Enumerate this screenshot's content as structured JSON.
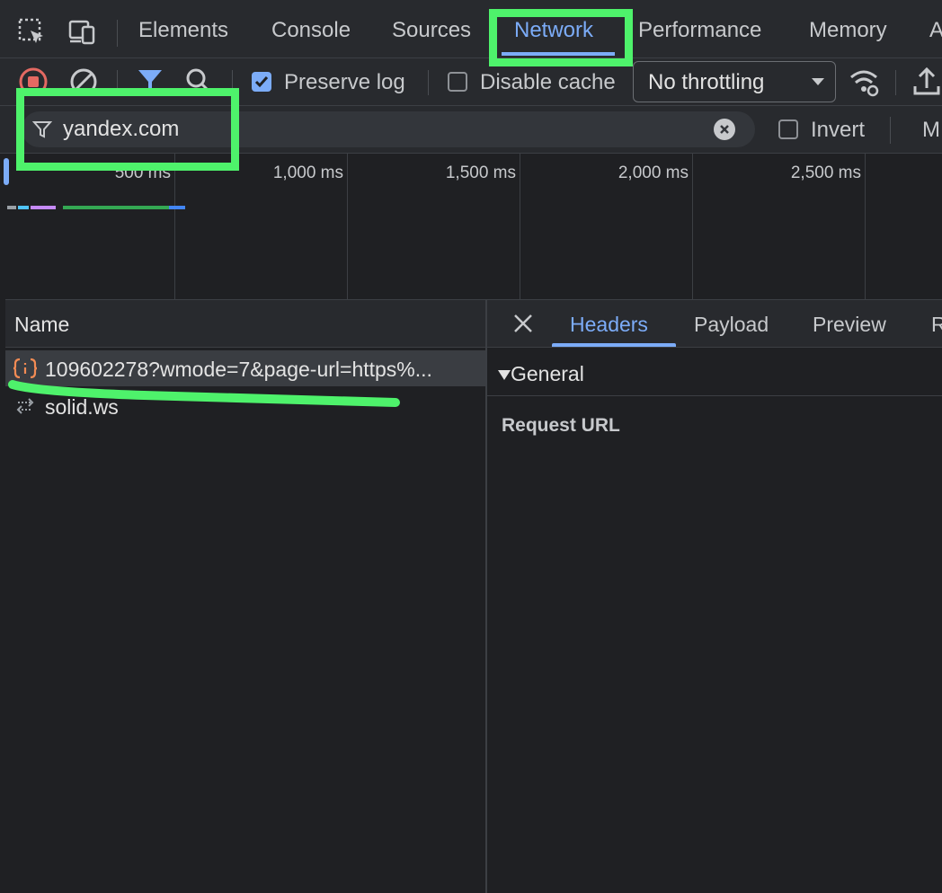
{
  "tabs": [
    {
      "label": "Elements"
    },
    {
      "label": "Console"
    },
    {
      "label": "Sources"
    },
    {
      "label": "Network",
      "active": true
    },
    {
      "label": "Performance"
    },
    {
      "label": "Memory"
    },
    {
      "label": "A"
    }
  ],
  "toolbar": {
    "preserve_log": {
      "label": "Preserve log",
      "checked": true
    },
    "disable_cache": {
      "label": "Disable cache",
      "checked": false
    },
    "throttling": {
      "selected": "No throttling"
    }
  },
  "filter": {
    "value": "yandex.com",
    "invert_label": "Invert",
    "more_label": "M"
  },
  "timeline": {
    "ticks": [
      "500 ms",
      "1,000 ms",
      "1,500 ms",
      "2,000 ms",
      "2,500 ms"
    ]
  },
  "requests": {
    "header": "Name",
    "items": [
      {
        "name": "109602278?wmode=7&page-url=https%...",
        "icon": "json-fetch-icon",
        "selected": true
      },
      {
        "name": "solid.ws",
        "icon": "websocket-icon",
        "selected": false
      }
    ]
  },
  "details": {
    "tabs": [
      "Headers",
      "Payload",
      "Preview",
      "R"
    ],
    "active_tab": "Headers",
    "section_title": "General",
    "field_label": "Request URL"
  },
  "colors": {
    "accent": "#7cacf8",
    "highlight": "#4ef26b",
    "record": "#e46962",
    "json_icon": "#f28b54"
  }
}
